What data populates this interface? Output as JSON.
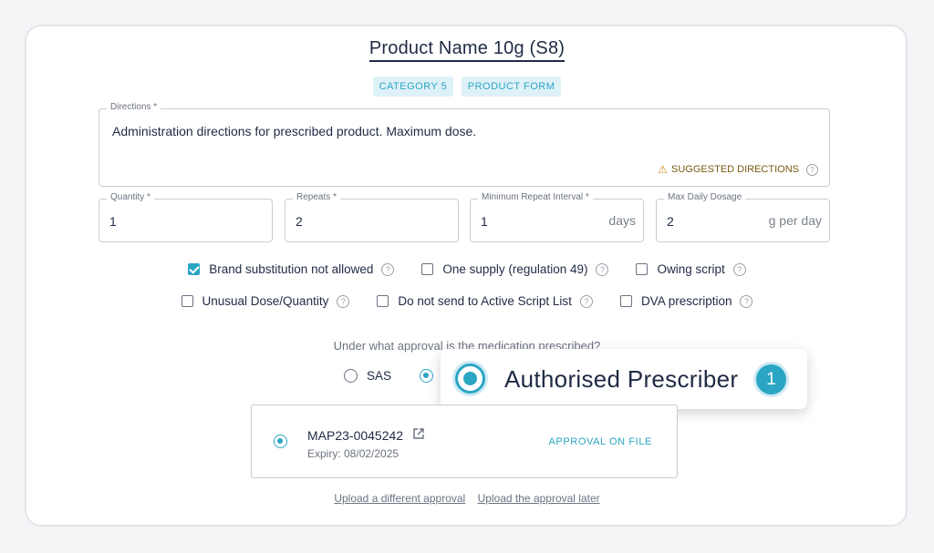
{
  "product": {
    "title": "Product Name 10g (S8)",
    "chips": [
      "CATEGORY 5",
      "PRODUCT FORM"
    ]
  },
  "directions": {
    "label": "Directions *",
    "value": "Administration directions for prescribed product. Maximum dose.",
    "suggested_label": "SUGGESTED DIRECTIONS"
  },
  "fields": {
    "quantity": {
      "label": "Quantity *",
      "value": "1"
    },
    "repeats": {
      "label": "Repeats *",
      "value": "2"
    },
    "min_interval": {
      "label": "Minimum Repeat Interval *",
      "value": "1",
      "unit": "days"
    },
    "max_daily": {
      "label": "Max Daily Dosage",
      "value": "2",
      "unit": "g per day"
    }
  },
  "checkboxes": [
    {
      "label": "Brand substitution not allowed",
      "checked": true
    },
    {
      "label": "One supply (regulation 49)",
      "checked": false
    },
    {
      "label": "Owing script",
      "checked": false
    },
    {
      "label": "Unusual Dose/Quantity",
      "checked": false
    },
    {
      "label": "Do not send to Active Script List",
      "checked": false
    },
    {
      "label": "DVA prescription",
      "checked": false
    }
  ],
  "approval": {
    "question": "Under what approval is the medication prescribed?",
    "sas_label": "SAS",
    "selected_label": "Authorised Prescriber",
    "step_badge": "1",
    "record": {
      "id": "MAP23-0045242",
      "expiry": "Expiry: 08/02/2025",
      "status": "APPROVAL ON FILE"
    },
    "link_upload_different": "Upload a different approval",
    "link_upload_later": "Upload the approval later"
  },
  "colors": {
    "accent": "#2aa6c4",
    "text": "#1f2a44"
  }
}
